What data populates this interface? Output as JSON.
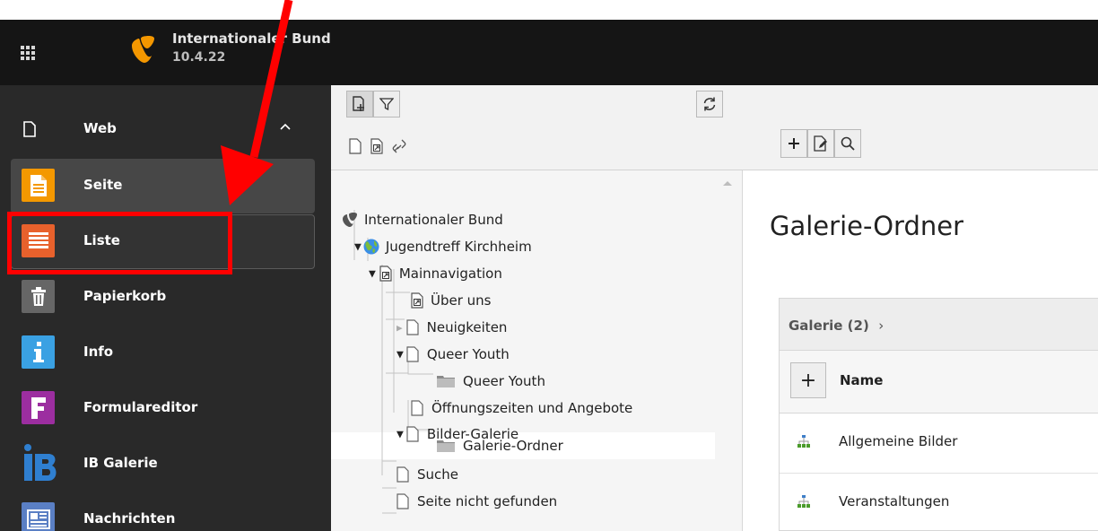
{
  "topbar": {
    "site_name": "Internationaler Bund",
    "version": "10.4.22",
    "apps_icon": "grid-icon",
    "tree_toggle_icon": "list-tree-icon",
    "logo": "typo3-logo"
  },
  "module_menu": {
    "group": {
      "label": "Web",
      "icon": "file-icon",
      "caret": "chevron-up-icon"
    },
    "items": [
      {
        "label": "Seite",
        "icon": "page-module-icon",
        "color": "#f49800"
      },
      {
        "label": "Liste",
        "icon": "list-module-icon",
        "color": "#e8612c"
      },
      {
        "label": "Papierkorb",
        "icon": "trash-module-icon",
        "color": "#666666"
      },
      {
        "label": "Info",
        "icon": "info-module-icon",
        "color": "#3aa1e3"
      },
      {
        "label": "Formulareditor",
        "icon": "form-module-icon",
        "color": "#9c2ea0"
      },
      {
        "label": "IB Galerie",
        "icon": "ib-logo-icon",
        "color": "#1e6bb8"
      },
      {
        "label": "Nachrichten",
        "icon": "news-module-icon",
        "color": "#5a7fc4"
      }
    ]
  },
  "tree_toolbar": {
    "new_page_icon": "new-page-icon",
    "filter_icon": "filter-icon",
    "refresh_icon": "refresh-icon",
    "drag_icons": [
      "page-icon",
      "shortcut-page-icon",
      "link-icon"
    ]
  },
  "page_tree": {
    "rows": [
      {
        "label": "Internationaler Bund",
        "icon": "typo3-root-icon"
      },
      {
        "label": "Jugendtreff Kirchheim",
        "icon": "globe-icon",
        "toggle": "▼"
      },
      {
        "label": "Mainnavigation",
        "icon": "shortcut-page-icon",
        "toggle": "▼"
      },
      {
        "label": "Über uns",
        "icon": "shortcut-page-icon"
      },
      {
        "label": "Neuigkeiten",
        "icon": "page-icon",
        "toggle": "▶"
      },
      {
        "label": "Queer Youth",
        "icon": "page-icon",
        "toggle": "▼"
      },
      {
        "label": "Queer Youth",
        "icon": "folder-icon"
      },
      {
        "label": "Öffnungszeiten und Angebote",
        "icon": "page-icon"
      },
      {
        "label": "Bilder-Galerie",
        "icon": "page-icon",
        "toggle": "▼"
      },
      {
        "label": "Galerie-Ordner",
        "icon": "folder-icon",
        "selected": true
      },
      {
        "label": "Suche",
        "icon": "page-icon"
      },
      {
        "label": "Seite nicht gefunden",
        "icon": "page-icon"
      }
    ]
  },
  "main": {
    "toolbar_icons": [
      "plus-icon",
      "edit-page-icon",
      "search-icon"
    ],
    "title": "Galerie-Ordner",
    "panel": {
      "heading": "Galerie (2)",
      "heading_caret": "›",
      "add_label": "+",
      "column": "Name",
      "rows": [
        {
          "label": "Allgemeine Bilder",
          "icon": "sitemap-icon"
        },
        {
          "label": "Veranstaltungen",
          "icon": "sitemap-icon"
        }
      ]
    }
  },
  "annotation": {
    "color": "#ff0000"
  }
}
